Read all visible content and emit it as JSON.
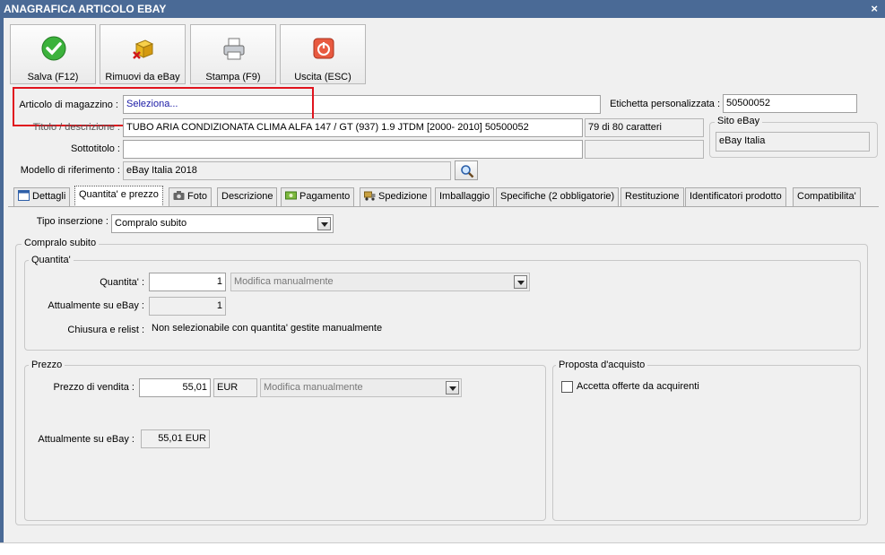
{
  "window": {
    "title": "ANAGRAFICA ARTICOLO EBAY",
    "close_glyph": "×"
  },
  "toolbar": {
    "buttons": [
      {
        "label": "Salva (F12)",
        "icon": "check-icon"
      },
      {
        "label": "Rimuovi da eBay",
        "icon": "box-remove-icon"
      },
      {
        "label": "Stampa (F9)",
        "icon": "printer-icon"
      },
      {
        "label": "Uscita (ESC)",
        "icon": "exit-icon"
      }
    ]
  },
  "form": {
    "articolo_label": "Articolo di magazzino :",
    "articolo_value": "Seleziona...",
    "etichetta_label": "Etichetta personalizzata :",
    "etichetta_value": "50500052",
    "titolo_label": "Titolo / descrizione :",
    "titolo_value": "TUBO ARIA CONDIZIONATA CLIMA ALFA 147 / GT (937) 1.9 JTDM [2000- 2010] 50500052",
    "char_count": "79 di 80 caratteri",
    "sottotitolo_label": "Sottotitolo :",
    "sottotitolo_value": "",
    "modello_label": "Modello di riferimento :",
    "modello_value": "eBay Italia 2018",
    "sito_title": "Sito eBay",
    "sito_value": "eBay Italia"
  },
  "tabs": [
    {
      "label": "Dettagli",
      "icon": "calendar-icon"
    },
    {
      "label": "Quantita' e prezzo",
      "icon": ""
    },
    {
      "label": "Foto",
      "icon": "camera-icon"
    },
    {
      "label": "Descrizione",
      "icon": ""
    },
    {
      "label": "Pagamento",
      "icon": "money-icon"
    },
    {
      "label": "Spedizione",
      "icon": "truck-icon"
    },
    {
      "label": "Imballaggio",
      "icon": ""
    },
    {
      "label": "Specifiche (2 obbligatorie)",
      "icon": ""
    },
    {
      "label": "Restituzione",
      "icon": ""
    },
    {
      "label": "Identificatori prodotto",
      "icon": ""
    },
    {
      "label": "Compatibilita'",
      "icon": ""
    }
  ],
  "panel": {
    "tipo_label": "Tipo inserzione :",
    "tipo_value": "Compralo subito",
    "compralo_title": "Compralo subito",
    "quantita_title": "Quantita'",
    "quantita_label": "Quantita' :",
    "quantita_value": "1",
    "quantita_mode": "Modifica manualmente",
    "attuale_q_label": "Attualmente su eBay :",
    "attuale_q_value": "1",
    "chiusura_label": "Chiusura e relist :",
    "chiusura_value": "Non selezionabile con quantita' gestite manualmente",
    "prezzo_title": "Prezzo",
    "prezzo_label": "Prezzo di vendita :",
    "prezzo_value": "55,01",
    "currency": "EUR",
    "prezzo_mode": "Modifica manualmente",
    "attuale_p_label": "Attualmente su eBay :",
    "attuale_p_value": "55,01 EUR",
    "proposta_title": "Proposta d'acquisto",
    "accetta_label": "Accetta offerte da acquirenti",
    "accetta_checked": false
  },
  "colors": {
    "titlebar": "#4a6a96",
    "highlight": "#e0141e"
  }
}
